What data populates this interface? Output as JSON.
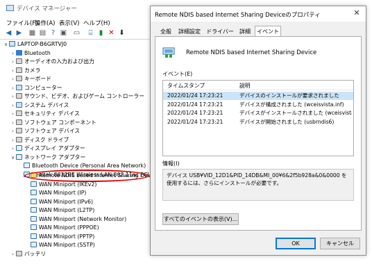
{
  "device_manager": {
    "title": "デバイス マネージャー",
    "menu": [
      "ファイル(F)",
      "操作(A)",
      "表示(V)",
      "ヘルプ(H)"
    ],
    "tree": [
      {
        "label": "LAPTOP-B6GRTVJ0",
        "expander": "∨",
        "icon": "computer-icon"
      },
      {
        "label": "Bluetooth",
        "expander": "›",
        "icon": "bluetooth-icon"
      },
      {
        "label": "オーディオの入力および出力",
        "expander": "›",
        "icon": "speaker-icon"
      },
      {
        "label": "カメラ",
        "expander": "›",
        "icon": "camera-icon"
      },
      {
        "label": "キーボード",
        "expander": "›",
        "icon": "keyboard-icon"
      },
      {
        "label": "コンピューター",
        "expander": "›",
        "icon": "computer-icon"
      },
      {
        "label": "サウンド、ビデオ、およびゲーム コントローラー",
        "expander": "›",
        "icon": "sound-icon"
      },
      {
        "label": "システム デバイス",
        "expander": "›",
        "icon": "system-device-icon"
      },
      {
        "label": "セキュリティ デバイス",
        "expander": "›",
        "icon": "security-icon"
      },
      {
        "label": "ソフトウェア コンポーネント",
        "expander": "›",
        "icon": "software-component-icon"
      },
      {
        "label": "ソフトウェア デバイス",
        "expander": "›",
        "icon": "software-device-icon"
      },
      {
        "label": "ディスク ドライブ",
        "expander": "›",
        "icon": "disk-drive-icon"
      },
      {
        "label": "ディスプレイ アダプター",
        "expander": "›",
        "icon": "display-adapter-icon"
      },
      {
        "label": "ネットワーク アダプター",
        "expander": "∨",
        "icon": "network-adapter-icon"
      },
      {
        "label": "Bluetooth Device (Personal Area Network)",
        "expander": "",
        "icon": "network-adapter-icon"
      },
      {
        "label": "Realtek 8822BE Wireless LAN 802.11ac PCI-E NI",
        "expander": "",
        "icon": "network-adapter-icon"
      },
      {
        "label": "Remote NDIS based Internet Sharing Device",
        "expander": "",
        "icon": "warning-network-adapter-icon"
      },
      {
        "label": "WAN Miniport (IKEv2)",
        "expander": "",
        "icon": "network-adapter-icon"
      },
      {
        "label": "WAN Miniport (IP)",
        "expander": "",
        "icon": "network-adapter-icon"
      },
      {
        "label": "WAN Miniport (IPv6)",
        "expander": "",
        "icon": "network-adapter-icon"
      },
      {
        "label": "WAN Miniport (L2TP)",
        "expander": "",
        "icon": "network-adapter-icon"
      },
      {
        "label": "WAN Miniport (Network Monitor)",
        "expander": "",
        "icon": "network-adapter-icon"
      },
      {
        "label": "WAN Miniport (PPPOE)",
        "expander": "",
        "icon": "network-adapter-icon"
      },
      {
        "label": "WAN Miniport (PPTP)",
        "expander": "",
        "icon": "network-adapter-icon"
      },
      {
        "label": "WAN Miniport (SSTP)",
        "expander": "",
        "icon": "network-adapter-icon"
      },
      {
        "label": "バッテリ",
        "expander": "›",
        "icon": "battery-icon"
      }
    ]
  },
  "dialog": {
    "title": "Remote NDIS based Internet Sharing Deviceのプロパティ",
    "tabs": [
      "全般",
      "詳細設定",
      "ドライバー",
      "詳細",
      "イベント"
    ],
    "active_tab": "イベント",
    "device_name": "Remote NDIS based Internet Sharing Device",
    "events_label": "イベント(E)",
    "columns": [
      "タイムスタンプ",
      "説明"
    ],
    "events": [
      {
        "timestamp": "2022/01/24 17:23:21",
        "description": "デバイスのインストールが要求されました"
      },
      {
        "timestamp": "2022/01/24 17:23:21",
        "description": "デバイスが構成されました (wceisvista.inf)"
      },
      {
        "timestamp": "2022/01/24 17:23:21",
        "description": "デバイスがインストールされました (wceisvista.inf..."
      },
      {
        "timestamp": "2022/01/24 17:23:21",
        "description": "デバイスが開始されました (usbrndis6)"
      }
    ],
    "info_label": "情報(I)",
    "info_text": "デバイス USB¥VID_12D1&PID_14DB&MI_00¥6&2f5b928a&0&0000 を使用するには、さらにインストールが必要です。",
    "show_all_button": "すべてのイベントの表示(V)...",
    "ok_button": "OK",
    "cancel_button": "キャンセル",
    "close_glyph": "✕"
  },
  "colors": {
    "selection": "#cce4f7",
    "highlight_ellipse": "#e00000",
    "accent": "#0078d7"
  }
}
